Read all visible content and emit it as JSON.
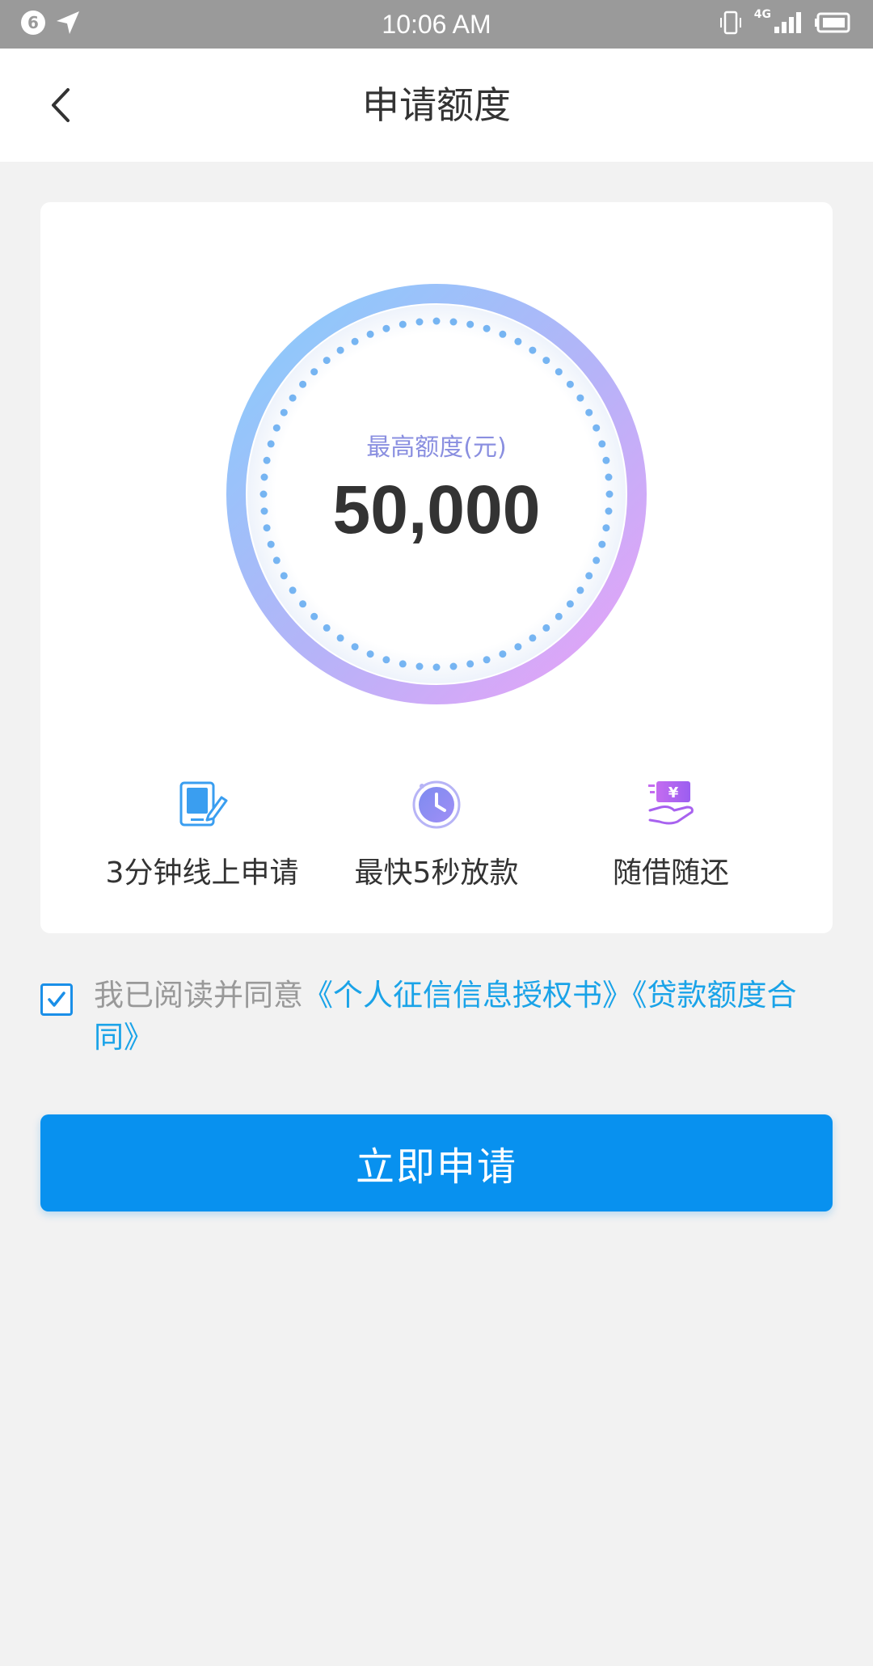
{
  "status_bar": {
    "notification_count": "6",
    "time": "10:06 AM",
    "network": "4G",
    "icons": [
      "location-arrow-icon",
      "vibrate-icon",
      "signal-icon",
      "battery-icon"
    ]
  },
  "header": {
    "title": "申请额度",
    "back_icon": "chevron-left-icon"
  },
  "quota": {
    "label": "最高额度(元)",
    "amount": "50,000"
  },
  "features": [
    {
      "icon": "edit-form-icon",
      "label": "3分钟线上申请"
    },
    {
      "icon": "clock-icon",
      "label": "最快5秒放款"
    },
    {
      "icon": "hand-money-icon",
      "label": "随借随还"
    }
  ],
  "agreement": {
    "checked": true,
    "prefix": "我已阅读并同意",
    "link1": "《个人征信信息授权书》",
    "link2": "《贷款额度合同》"
  },
  "apply_button": {
    "label": "立即申请"
  },
  "colors": {
    "primary": "#0891ef",
    "link": "#1aa3e8",
    "gauge_start": "#86cdfb",
    "gauge_end": "#eaa1f7",
    "page_bg": "#f2f2f2"
  }
}
